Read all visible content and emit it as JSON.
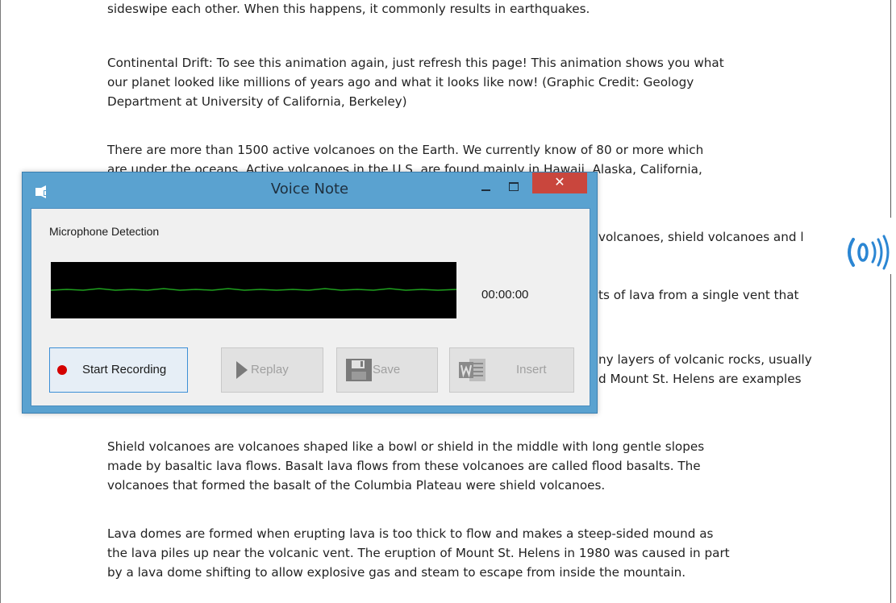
{
  "document": {
    "paragraphs": [
      "sideswipe each other. When this happens, it commonly results in earthquakes.",
      "Continental Drift: To see this animation again, just refresh this page! This animation shows you what\nour planet looked like millions of years ago and what it looks like now! (Graphic Credit: Geology\nDepartment at University of California, Berkeley)",
      "There are more than 1500 active volcanoes on the Earth. We currently know of 80 or more which\nare under the oceans. Active volcanoes in the U.S. are found mainly in Hawaii, Alaska, California,",
      "volcanoes, shield volcanoes and l",
      "ts of lava from a single vent that",
      "ny layers of volcanic rocks, usually\nd Mount St. Helens are examples",
      "Shield volcanoes are volcanoes shaped like a bowl or shield in the middle with long gentle slopes\nmade by basaltic lava flows. Basalt lava flows from these volcanoes are called flood basalts. The\nvolcanoes that formed the basalt of the Columbia Plateau were shield volcanoes.",
      "Lava domes are formed when erupting lava is too thick to flow and makes a steep-sided mound as\nthe lava piles up near the volcanic vent. The eruption of Mount St. Helens in 1980 was caused in part\nby a lava dome shifting to allow explosive gas and steam to escape from inside the mountain."
    ]
  },
  "window": {
    "title": "Voice Note",
    "close_glyph": "✕",
    "microphone_label": "Microphone Detection",
    "timer": "00:00:00",
    "buttons": {
      "start_recording": "Start Recording",
      "replay": "Replay",
      "save": "Save",
      "insert": "Insert"
    }
  },
  "icons": {
    "app": "voice-note-app-icon",
    "record": "record-dot-icon",
    "play": "play-icon",
    "save": "floppy-disk-icon",
    "insert": "word-document-icon",
    "sound": "sound-waves-icon"
  },
  "colors": {
    "titlebar": "#5aa2d0",
    "close_button": "#c9463d",
    "record_dot": "#d40000",
    "waveform_line": "#1fa11f",
    "sound_icon": "#2b86d3"
  }
}
